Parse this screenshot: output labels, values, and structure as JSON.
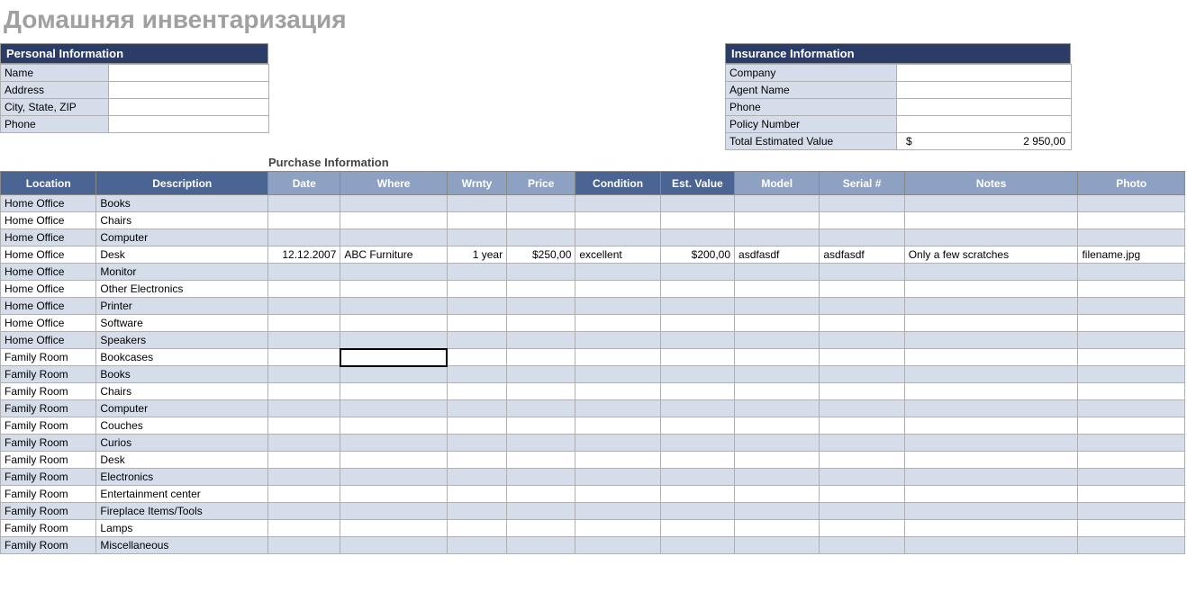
{
  "title": "Домашняя инвентаризация",
  "personal": {
    "header": "Personal Information",
    "labels": {
      "name": "Name",
      "address": "Address",
      "csz": "City, State, ZIP",
      "phone": "Phone"
    },
    "values": {
      "name": "",
      "address": "",
      "csz": "",
      "phone": ""
    }
  },
  "insurance": {
    "header": "Insurance Information",
    "labels": {
      "company": "Company",
      "agent": "Agent Name",
      "phone": "Phone",
      "policy": "Policy Number",
      "total": "Total Estimated Value"
    },
    "values": {
      "company": "",
      "agent": "",
      "phone": "",
      "policy": "",
      "total_currency": "$",
      "total_amount": "2 950,00"
    }
  },
  "purchase_label": "Purchase Information",
  "columns": {
    "location": "Location",
    "description": "Description",
    "date": "Date",
    "where": "Where",
    "wrnty": "Wrnty",
    "price": "Price",
    "condition": "Condition",
    "estvalue": "Est. Value",
    "model": "Model",
    "serial": "Serial #",
    "notes": "Notes",
    "photo": "Photo"
  },
  "rows": [
    {
      "location": "Home Office",
      "description": "Books"
    },
    {
      "location": "Home Office",
      "description": "Chairs"
    },
    {
      "location": "Home Office",
      "description": "Computer"
    },
    {
      "location": "Home Office",
      "description": "Desk",
      "date": "12.12.2007",
      "where": "ABC Furniture",
      "wrnty": "1 year",
      "price": "$250,00",
      "condition": "excellent",
      "estvalue": "$200,00",
      "model": "asdfasdf",
      "serial": "asdfasdf",
      "notes": "Only a few scratches",
      "photo": "filename.jpg"
    },
    {
      "location": "Home Office",
      "description": "Monitor"
    },
    {
      "location": "Home Office",
      "description": "Other Electronics"
    },
    {
      "location": "Home Office",
      "description": "Printer"
    },
    {
      "location": "Home Office",
      "description": "Software"
    },
    {
      "location": "Home Office",
      "description": "Speakers"
    },
    {
      "location": "Family Room",
      "description": "Bookcases"
    },
    {
      "location": "Family Room",
      "description": "Books"
    },
    {
      "location": "Family Room",
      "description": "Chairs"
    },
    {
      "location": "Family Room",
      "description": "Computer"
    },
    {
      "location": "Family Room",
      "description": "Couches"
    },
    {
      "location": "Family Room",
      "description": "Curios"
    },
    {
      "location": "Family Room",
      "description": "Desk"
    },
    {
      "location": "Family Room",
      "description": "Electronics"
    },
    {
      "location": "Family Room",
      "description": "Entertainment center"
    },
    {
      "location": "Family Room",
      "description": "Fireplace Items/Tools"
    },
    {
      "location": "Family Room",
      "description": "Lamps"
    },
    {
      "location": "Family Room",
      "description": "Miscellaneous"
    }
  ],
  "active_cell": {
    "row": 9,
    "col": "where"
  }
}
